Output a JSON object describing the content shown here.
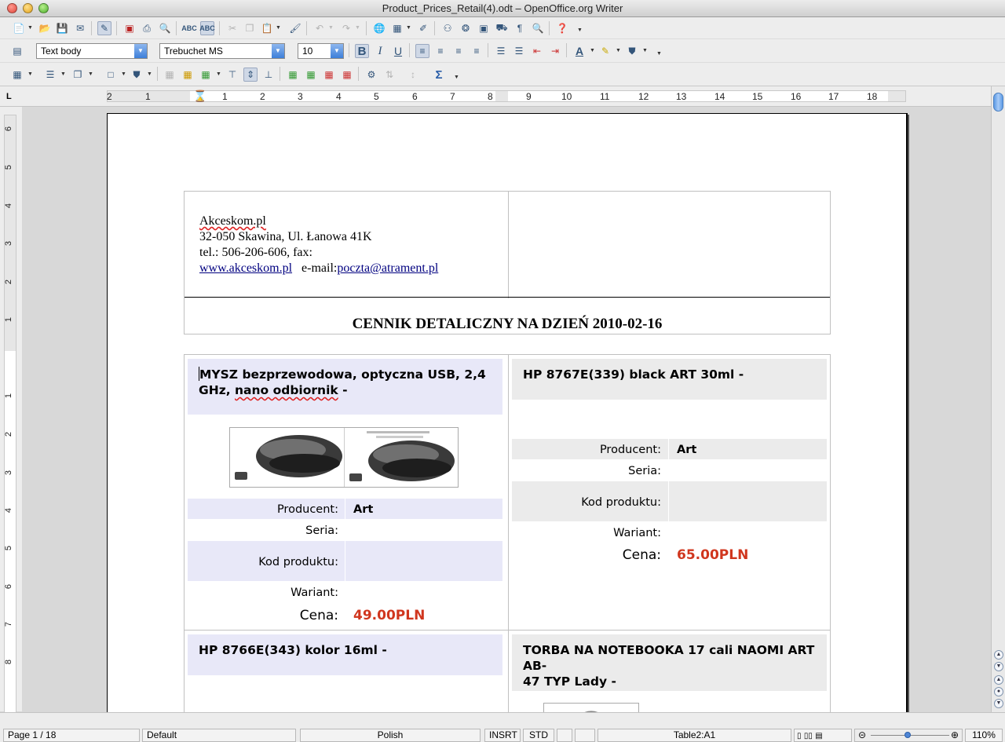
{
  "window": {
    "title": "Product_Prices_Retail(4).odt – OpenOffice.org Writer"
  },
  "formatting": {
    "paragraph_style": "Text body",
    "font_name": "Trebuchet MS",
    "font_size": "10"
  },
  "ruler": {
    "h_labels": [
      "2",
      "1",
      "1",
      "2",
      "3",
      "4",
      "5",
      "6",
      "7",
      "8",
      "9",
      "10",
      "11",
      "12",
      "13",
      "14",
      "15",
      "16",
      "17",
      "18"
    ],
    "v_labels": [
      "6",
      "5",
      "4",
      "3",
      "2",
      "1",
      "1",
      "2",
      "3",
      "4",
      "5",
      "6",
      "7",
      "8"
    ],
    "corner": "L"
  },
  "document": {
    "address": {
      "company": "Akceskom.pl",
      "street": "32-050 Skawina, Ul. Łanowa 41K",
      "phone": "tel.: 506-206-606, fax:",
      "website": "www.akceskom.pl",
      "email_label": "e-mail:",
      "email": "poczta@atrament.pl"
    },
    "heading": "CENNIK DETALICZNY NA DZIEŃ 2010-02-16",
    "products": [
      {
        "name_line1": "MYSZ bezprzewodowa, optyczna USB, 2,4",
        "name_line2_pre": "GHz, ",
        "name_line2_wavy": "nano odbiornik",
        "name_line2_post": " -",
        "producent_label": "Producent:",
        "producent": "Art",
        "seria_label": "Seria:",
        "kod_label": "Kod produktu:",
        "wariant_label": "Wariant:",
        "cena_label": "Cena:",
        "cena": "49.00PLN"
      },
      {
        "name": "HP 8767E(339) black ART 30ml -",
        "producent_label": "Producent:",
        "producent": "Art",
        "seria_label": "Seria:",
        "kod_label": "Kod produktu:",
        "wariant_label": "Wariant:",
        "cena_label": "Cena:",
        "cena": "65.00PLN"
      },
      {
        "name": "HP 8766E(343) kolor 16ml -"
      },
      {
        "name_line1": "TORBA NA NOTEBOOKA 17 cali NAOMI ART AB-",
        "name_line2": "47 TYP Lady -"
      }
    ]
  },
  "status": {
    "page": "Page 1 / 18",
    "style": "Default",
    "language": "Polish",
    "insert_mode": "INSRT",
    "selection_mode": "STD",
    "cell": "Table2:A1",
    "zoom": "110%"
  }
}
